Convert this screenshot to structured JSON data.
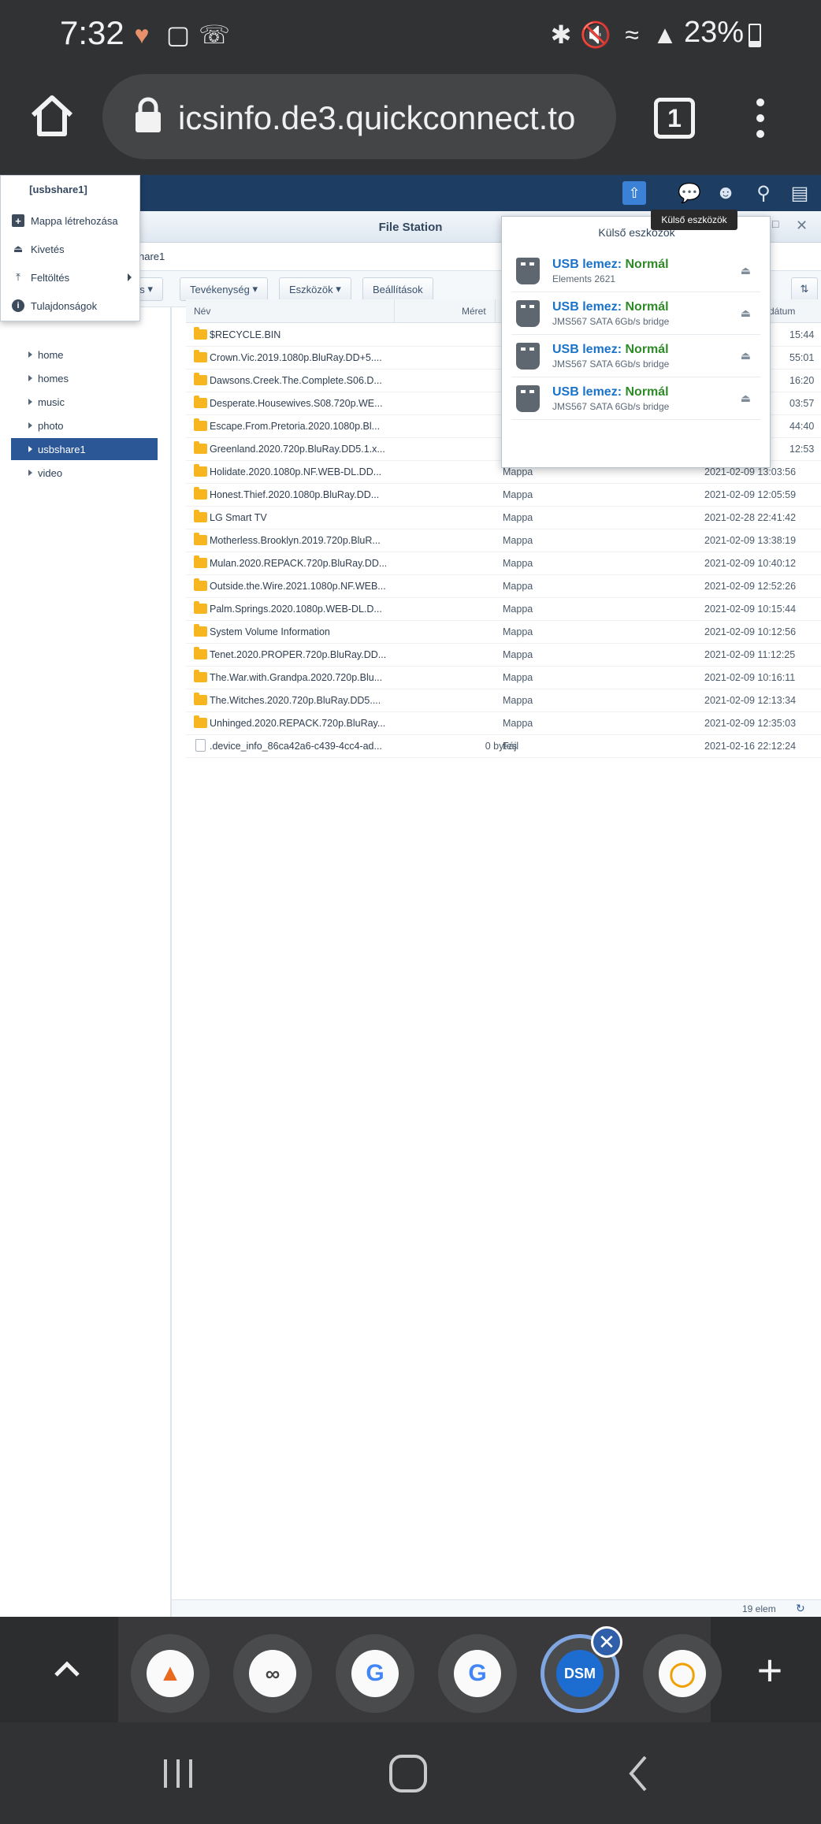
{
  "status_bar": {
    "time": "7:32",
    "battery": "23%",
    "icons": [
      "heart-rate-icon",
      "shopping-bag-icon",
      "viber-icon",
      "bluetooth-icon",
      "mute-icon",
      "wifi-icon",
      "signal-icon",
      "battery-icon"
    ]
  },
  "browser": {
    "url": "icsinfo.de3.quickconnect.to",
    "tab_count": "1"
  },
  "dsm": {
    "window_title": "File Station",
    "path_fragment": "hare1",
    "toolbar": {
      "upload_fragment": "ás",
      "action": "Tevékenység",
      "tools": "Eszközök",
      "settings": "Beállítások"
    },
    "tooltip": "Külső eszközök",
    "sidebar": {
      "items": [
        {
          "label": "home",
          "selected": false
        },
        {
          "label": "homes",
          "selected": false
        },
        {
          "label": "music",
          "selected": false
        },
        {
          "label": "photo",
          "selected": false
        },
        {
          "label": "usbshare1",
          "selected": true
        },
        {
          "label": "video",
          "selected": false
        }
      ]
    },
    "columns": {
      "name": "Név",
      "size": "Méret",
      "date_fragment": "dátum"
    },
    "files": [
      {
        "name": "$RECYCLE.BIN",
        "size": "",
        "type": "",
        "date": "15:44",
        "kind": "folder"
      },
      {
        "name": "Crown.Vic.2019.1080p.BluRay.DD+5....",
        "size": "",
        "type": "",
        "date": "55:01",
        "kind": "folder"
      },
      {
        "name": "Dawsons.Creek.The.Complete.S06.D...",
        "size": "",
        "type": "",
        "date": "16:20",
        "kind": "folder"
      },
      {
        "name": "Desperate.Housewives.S08.720p.WE...",
        "size": "",
        "type": "",
        "date": "03:57",
        "kind": "folder"
      },
      {
        "name": "Escape.From.Pretoria.2020.1080p.Bl...",
        "size": "",
        "type": "",
        "date": "44:40",
        "kind": "folder"
      },
      {
        "name": "Greenland.2020.720p.BluRay.DD5.1.x...",
        "size": "",
        "type": "",
        "date": "12:53",
        "kind": "folder"
      },
      {
        "name": "Holidate.2020.1080p.NF.WEB-DL.DD...",
        "size": "",
        "type": "Mappa",
        "date": "2021-02-09 13:03:56",
        "kind": "folder"
      },
      {
        "name": "Honest.Thief.2020.1080p.BluRay.DD...",
        "size": "",
        "type": "Mappa",
        "date": "2021-02-09 12:05:59",
        "kind": "folder"
      },
      {
        "name": "LG Smart TV",
        "size": "",
        "type": "Mappa",
        "date": "2021-02-28 22:41:42",
        "kind": "folder"
      },
      {
        "name": "Motherless.Brooklyn.2019.720p.BluR...",
        "size": "",
        "type": "Mappa",
        "date": "2021-02-09 13:38:19",
        "kind": "folder"
      },
      {
        "name": "Mulan.2020.REPACK.720p.BluRay.DD...",
        "size": "",
        "type": "Mappa",
        "date": "2021-02-09 10:40:12",
        "kind": "folder"
      },
      {
        "name": "Outside.the.Wire.2021.1080p.NF.WEB...",
        "size": "",
        "type": "Mappa",
        "date": "2021-02-09 12:52:26",
        "kind": "folder"
      },
      {
        "name": "Palm.Springs.2020.1080p.WEB-DL.D...",
        "size": "",
        "type": "Mappa",
        "date": "2021-02-09 10:15:44",
        "kind": "folder"
      },
      {
        "name": "System Volume Information",
        "size": "",
        "type": "Mappa",
        "date": "2021-02-09 10:12:56",
        "kind": "folder"
      },
      {
        "name": "Tenet.2020.PROPER.720p.BluRay.DD...",
        "size": "",
        "type": "Mappa",
        "date": "2021-02-09 11:12:25",
        "kind": "folder"
      },
      {
        "name": "The.War.with.Grandpa.2020.720p.Blu...",
        "size": "",
        "type": "Mappa",
        "date": "2021-02-09 10:16:11",
        "kind": "folder"
      },
      {
        "name": "The.Witches.2020.720p.BluRay.DD5....",
        "size": "",
        "type": "Mappa",
        "date": "2021-02-09 12:13:34",
        "kind": "folder"
      },
      {
        "name": "Unhinged.2020.REPACK.720p.BluRay....",
        "size": "",
        "type": "Mappa",
        "date": "2021-02-09 12:35:03",
        "kind": "folder"
      },
      {
        "name": ".device_info_86ca42a6-c439-4cc4-ad...",
        "size": "0 bytes",
        "type": "Fájl",
        "date": "2021-02-16 22:12:24",
        "kind": "file"
      }
    ],
    "item_count": "19 elem",
    "context_menu": {
      "header": "[usbshare1]",
      "items": [
        {
          "label": "Mappa létrehozása",
          "icon": "plus-icon"
        },
        {
          "label": "Kivetés",
          "icon": "eject-icon"
        },
        {
          "label": "Feltöltés",
          "icon": "upload-icon"
        },
        {
          "label": "Tulajdonságok",
          "icon": "info-icon"
        }
      ]
    },
    "external_devices": {
      "title": "Külső eszközök",
      "devices": [
        {
          "name": "USB lemez:",
          "status": "Normál",
          "model": "Elements 2621"
        },
        {
          "name": "USB lemez:",
          "status": "Normál",
          "model": "JMS567 SATA 6Gb/s bridge"
        },
        {
          "name": "USB lemez:",
          "status": "Normál",
          "model": "JMS567 SATA 6Gb/s bridge"
        },
        {
          "name": "USB lemez:",
          "status": "Normál",
          "model": "JMS567 SATA 6Gb/s bridge"
        }
      ]
    }
  },
  "recent_apps": [
    "chevron-up-icon",
    "app-1-icon",
    "app-2-icon",
    "google-icon",
    "google-icon",
    "dsm-icon",
    "app-6-icon",
    "add-icon"
  ],
  "dsm_app_label": "DSM",
  "colors": {
    "dsm_header": "#1e3d63",
    "selected": "#2b5797",
    "status_ok": "#2e8b27",
    "link_blue": "#1a73c9",
    "folder": "#f7b520"
  }
}
